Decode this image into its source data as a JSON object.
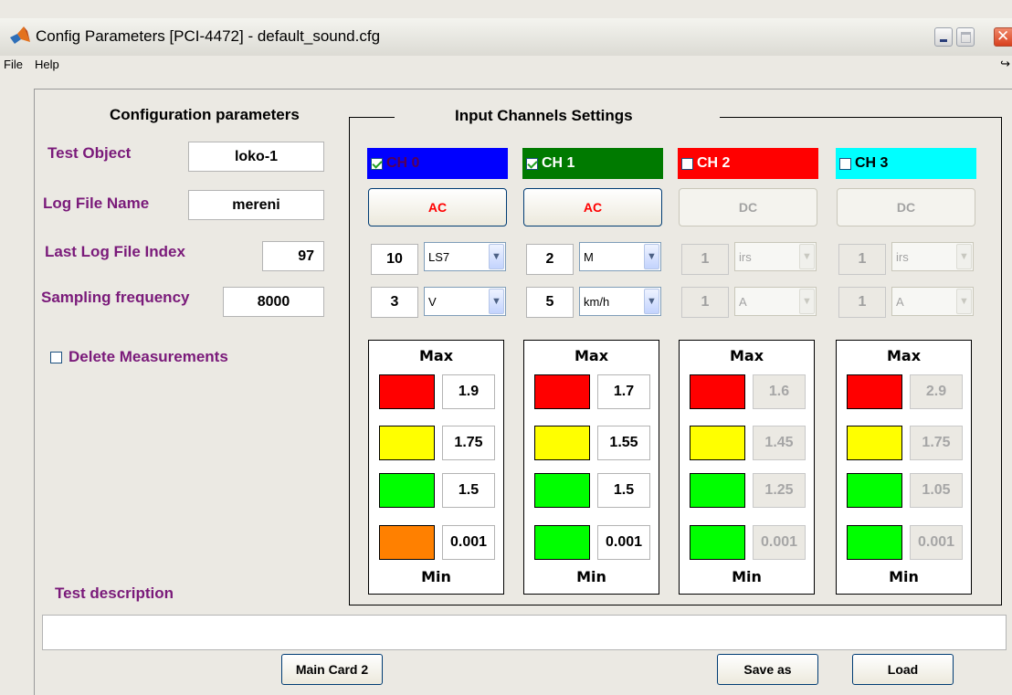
{
  "window": {
    "title": "Config Parameters [PCI-4472] - default_sound.cfg"
  },
  "menu": {
    "file": "File",
    "help": "Help"
  },
  "config": {
    "heading": "Configuration parameters",
    "test_object_label": "Test Object",
    "test_object_value": "loko-1",
    "log_file_label": "Log File Name",
    "log_file_value": "mereni",
    "last_index_label": "Last Log File Index",
    "last_index_value": "97",
    "sampling_label": "Sampling frequency",
    "sampling_value": "8000",
    "delete_label": "Delete Measurements",
    "delete_checked": false
  },
  "channels_panel": {
    "title": "Input Channels Settings"
  },
  "channels": [
    {
      "name": "CH 0",
      "checked": true,
      "header_color": "#0000ff",
      "coupling": "AC",
      "enabled": true,
      "num1": "10",
      "sel1": "LS7",
      "num2": "3",
      "sel2": "V",
      "max_label": "Max",
      "min_label": "Min",
      "limits": [
        {
          "color": "#ff0000",
          "value": "1.9"
        },
        {
          "color": "#ffff00",
          "value": "1.75"
        },
        {
          "color": "#00ff00",
          "value": "1.5"
        },
        {
          "color": "#ff8000",
          "value": "0.001"
        }
      ]
    },
    {
      "name": "CH 1",
      "checked": true,
      "header_color": "#007a00",
      "coupling": "AC",
      "enabled": true,
      "num1": "2",
      "sel1": "M",
      "num2": "5",
      "sel2": "km/h",
      "max_label": "Max",
      "min_label": "Min",
      "limits": [
        {
          "color": "#ff0000",
          "value": "1.7"
        },
        {
          "color": "#ffff00",
          "value": "1.55"
        },
        {
          "color": "#00ff00",
          "value": "1.5"
        },
        {
          "color": "#00ff00",
          "value": "0.001"
        }
      ]
    },
    {
      "name": "CH 2",
      "checked": false,
      "header_color": "#ff0000",
      "coupling": "DC",
      "enabled": false,
      "num1": "1",
      "sel1": "irs",
      "num2": "1",
      "sel2": "A",
      "max_label": "Max",
      "min_label": "Min",
      "limits": [
        {
          "color": "#ff0000",
          "value": "1.6"
        },
        {
          "color": "#ffff00",
          "value": "1.45"
        },
        {
          "color": "#00ff00",
          "value": "1.25"
        },
        {
          "color": "#00ff00",
          "value": "0.001"
        }
      ]
    },
    {
      "name": "CH 3",
      "checked": false,
      "header_color": "#00ffff",
      "coupling": "DC",
      "enabled": false,
      "num1": "1",
      "sel1": "irs",
      "num2": "1",
      "sel2": "A",
      "max_label": "Max",
      "min_label": "Min",
      "limits": [
        {
          "color": "#ff0000",
          "value": "2.9"
        },
        {
          "color": "#ffff00",
          "value": "1.75"
        },
        {
          "color": "#00ff00",
          "value": "1.05"
        },
        {
          "color": "#00ff00",
          "value": "0.001"
        }
      ]
    }
  ],
  "description": {
    "label": "Test description",
    "value": ""
  },
  "buttons": {
    "main_card": "Main Card 2",
    "save_as": "Save as",
    "load": "Load"
  },
  "icons": {
    "app": "matlab-icon",
    "minimize": "minimize-icon",
    "maximize": "maximize-icon",
    "close": "close-icon",
    "menu_overflow": "overflow-arrow-icon"
  }
}
